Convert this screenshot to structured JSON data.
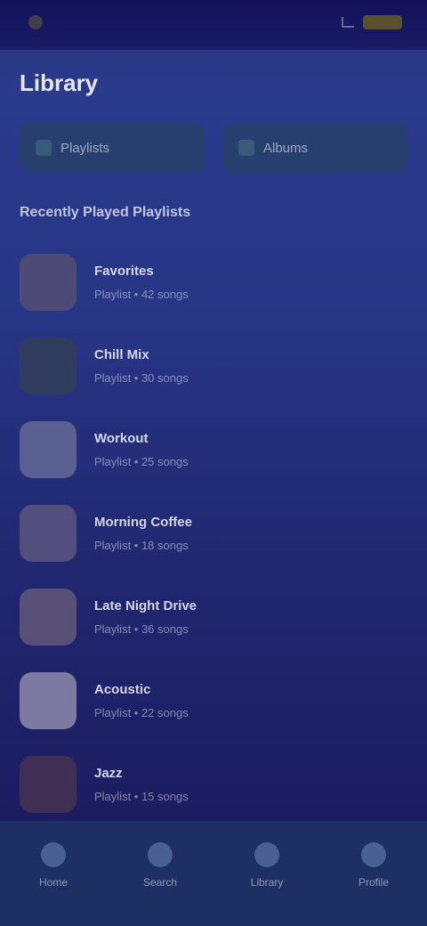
{
  "status_bar": {
    "time": "",
    "battery": ""
  },
  "header": {
    "title": "Library"
  },
  "tabs": [
    {
      "label": "Playlists"
    },
    {
      "label": "Albums"
    }
  ],
  "section": {
    "title": "Recently Played Playlists"
  },
  "list": [
    {
      "name": "Favorites",
      "subtitle": "Playlist • 42 songs",
      "color": "#4d4a78"
    },
    {
      "name": "Chill Mix",
      "subtitle": "Playlist • 30 songs",
      "color": "#2f3c5e"
    },
    {
      "name": "Workout",
      "subtitle": "Playlist • 25 songs",
      "color": "#5a5f92"
    },
    {
      "name": "Morning Coffee",
      "subtitle": "Playlist • 18 songs",
      "color": "#524f7e"
    },
    {
      "name": "Late Night Drive",
      "subtitle": "Playlist • 36 songs",
      "color": "#585077"
    },
    {
      "name": "Acoustic",
      "subtitle": "Playlist • 22 songs",
      "color": "#7c7aa3"
    },
    {
      "name": "Jazz",
      "subtitle": "Playlist • 15 songs",
      "color": "#3f2f55"
    }
  ],
  "bottom_nav": [
    {
      "label": "Home",
      "icon": "home-icon"
    },
    {
      "label": "Search",
      "icon": "search-icon"
    },
    {
      "label": "Library",
      "icon": "library-icon"
    },
    {
      "label": "Profile",
      "icon": "profile-icon"
    }
  ]
}
